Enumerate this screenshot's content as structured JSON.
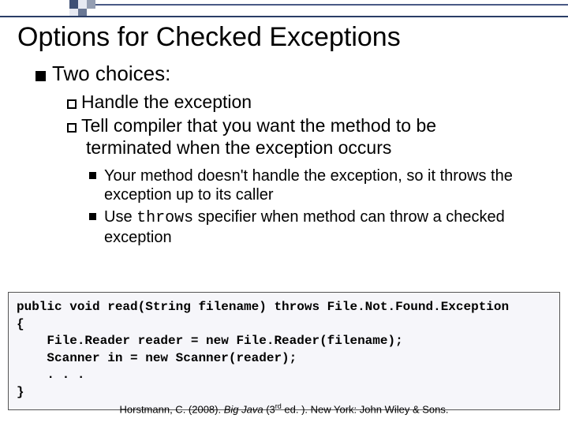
{
  "title": "Options for Checked Exceptions",
  "lvl1": "Two choices:",
  "lvl2a_lead": "Handle",
  "lvl2a_rest": " the exception",
  "lvl2b_lead": "Tell",
  "lvl2b_rest": " compiler that you want the method to be",
  "lvl2b_cont": "terminated when the exception occurs",
  "lvl3a": "Your method doesn't handle the exception, so it throws the exception up to its caller",
  "lvl3b_pre": "Use ",
  "lvl3b_code": "throws",
  "lvl3b_post": " specifier when method can throw a checked exception",
  "code": "public void read(String filename) throws File.Not.Found.Exception\n{\n    File.Reader reader = new File.Reader(filename);\n    Scanner in = new Scanner(reader);\n    . . .\n}",
  "cite_pre": "Horstmann, C. (2008). ",
  "cite_title": "Big Java",
  "cite_edition_open": " (3",
  "cite_edition_sup": "rd",
  "cite_edition_close": " ed. ). New York: John Wiley & Sons."
}
